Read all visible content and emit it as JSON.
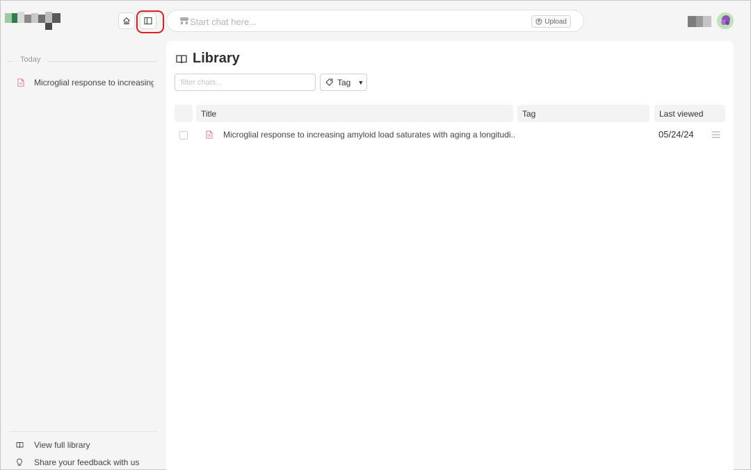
{
  "header": {
    "search": {
      "placeholder": "Start chat here...",
      "value": ""
    },
    "upload_label": "Upload",
    "icons": {
      "home": "home-icon",
      "sidebar_toggle": "sidebar-toggle-icon",
      "chat": "chat-bot-icon",
      "upload": "upload-circle-icon",
      "avatar": "user-avatar"
    }
  },
  "sidebar": {
    "section_label": "Today",
    "history": [
      {
        "label": "Microglial response to increasing",
        "icon": "pdf-file-icon"
      }
    ],
    "footer": [
      {
        "label": "View full library",
        "icon": "book-icon"
      },
      {
        "label": "Share your feedback with us",
        "icon": "lightbulb-icon"
      }
    ]
  },
  "main": {
    "title": "Library",
    "title_icon": "book-open-icon",
    "filter": {
      "placeholder": "filter chats...",
      "value": ""
    },
    "tag_label": "Tag",
    "columns": [
      "Title",
      "Tag",
      "Last viewed"
    ],
    "rows": [
      {
        "title": "Microglial response to increasing amyloid load saturates with aging a longitudi...",
        "tag": "",
        "last_viewed": "05/24/24"
      }
    ]
  },
  "colors": {
    "accent_red": "#e01e1e",
    "pdf_pink": "#e26a8a",
    "page_bg": "#f5f5f5"
  }
}
